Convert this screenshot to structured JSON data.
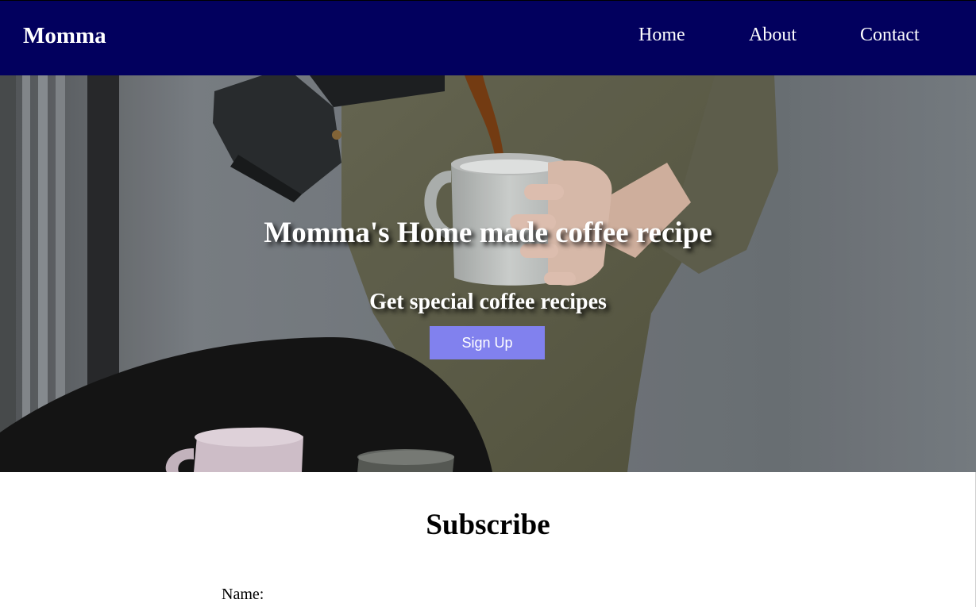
{
  "navbar": {
    "brand": "Momma",
    "links": [
      "Home",
      "About",
      "Contact"
    ],
    "background_color": "#02005e"
  },
  "hero": {
    "title": "Momma's Home made coffee recipe",
    "subtitle": "Get special coffee recipes",
    "signup_label": "Sign Up",
    "button_color": "#8181ee",
    "image_description": "coffee-pour-photo"
  },
  "subscribe": {
    "title": "Subscribe",
    "name_label": "Name:"
  }
}
